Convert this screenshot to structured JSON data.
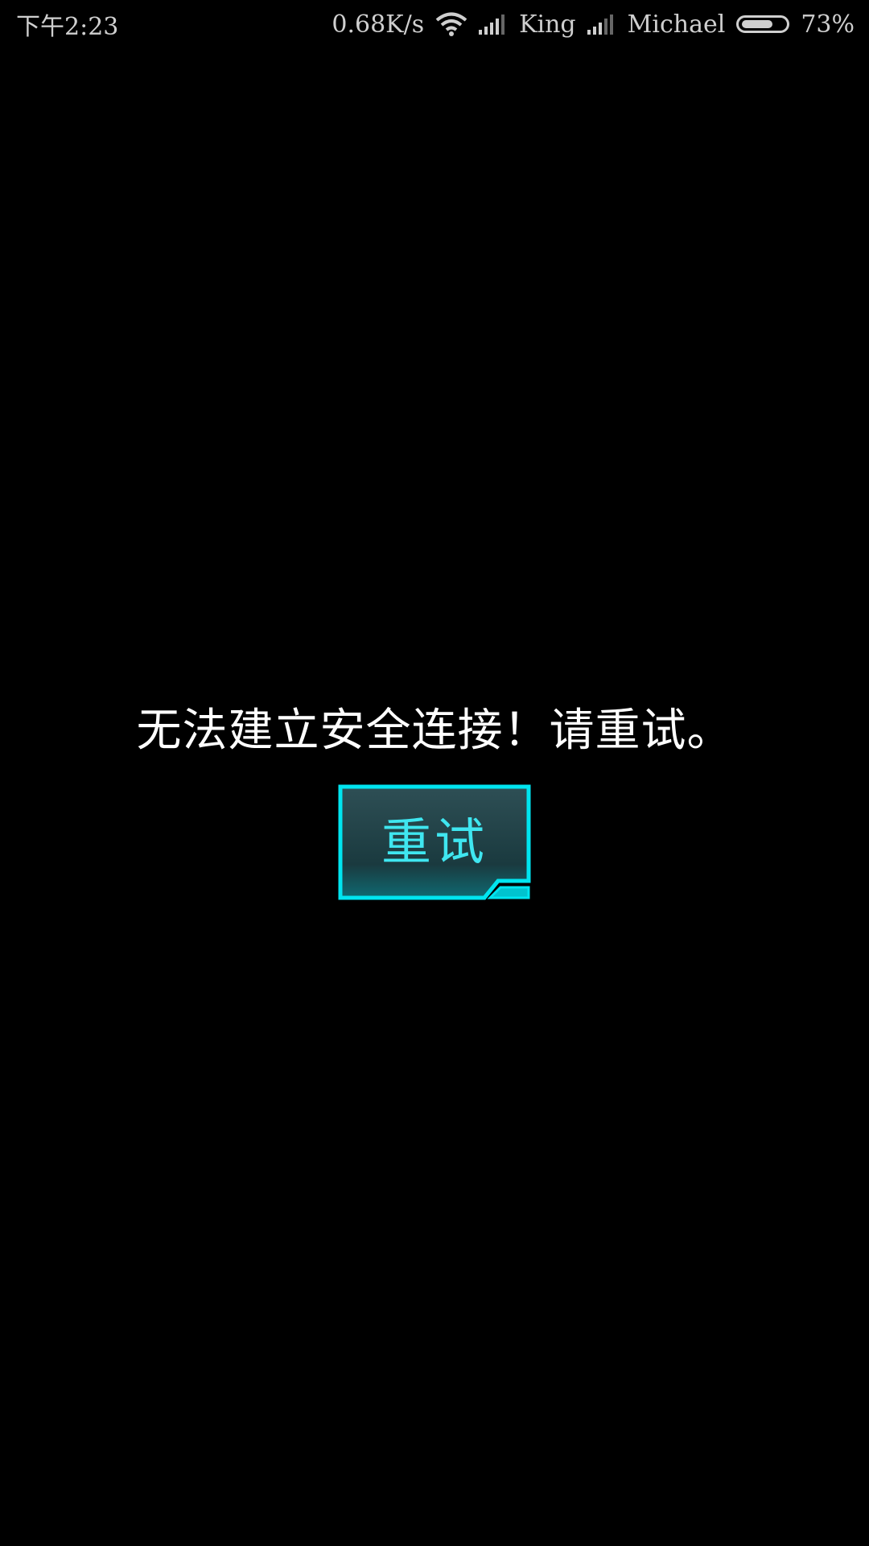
{
  "status_bar": {
    "time": "下午2:23",
    "net_speed": "0.68K/s",
    "carrier_1": "King",
    "carrier_2": "Michael",
    "battery_percent": "73%",
    "battery_level": 0.73,
    "icons": [
      "wifi-icon",
      "signal-icon",
      "signal-icon",
      "battery-icon"
    ]
  },
  "dialog": {
    "message": "无法建立安全连接！请重试。",
    "retry_label": "重试"
  },
  "colors": {
    "background": "#000000",
    "accent": "#00e5f0",
    "button_fill": "#1c3f44"
  }
}
